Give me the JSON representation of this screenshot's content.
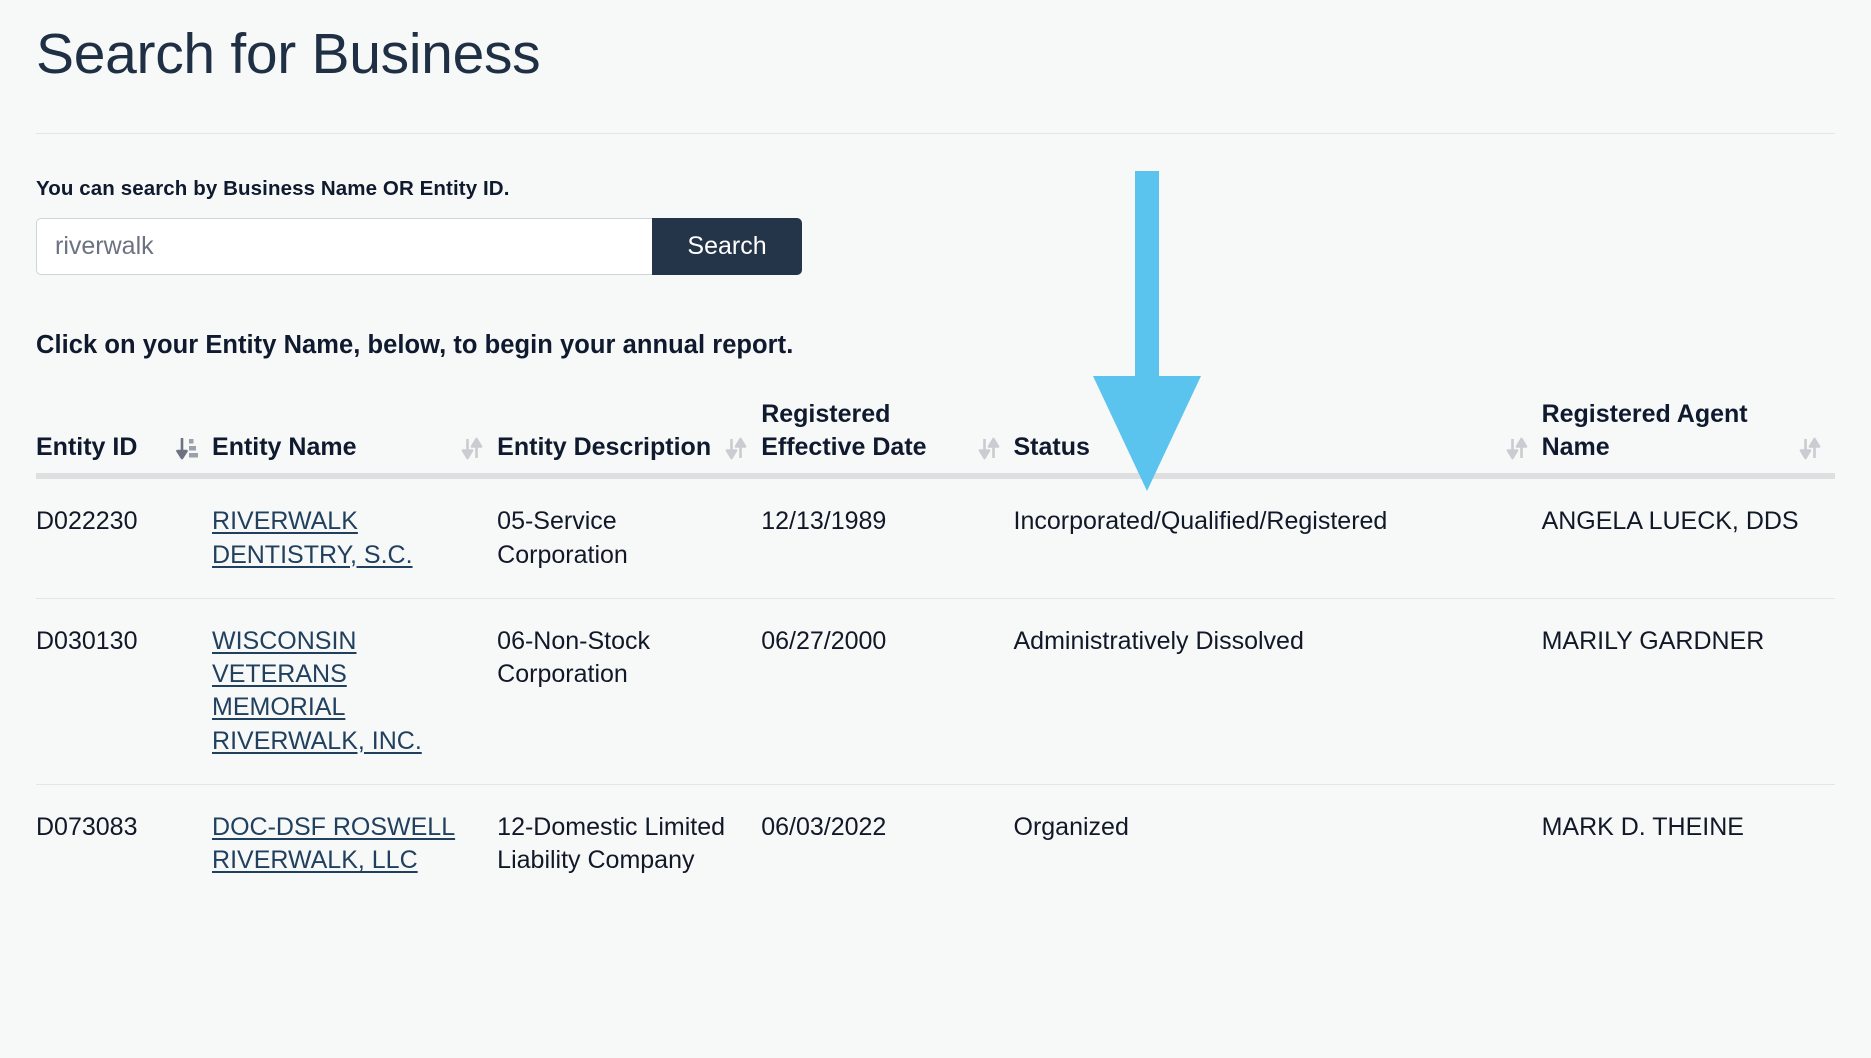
{
  "header": {
    "title": "Search for Business"
  },
  "search": {
    "help_text": "You can search by Business Name OR Entity ID.",
    "value": "riverwalk",
    "placeholder": "riverwalk",
    "button_label": "Search"
  },
  "instruction": "Click on your Entity Name, below, to begin your annual report.",
  "annotation": {
    "arrow_icon": "down-arrow-annotation",
    "color": "#5BC4EE",
    "points_to": "Status"
  },
  "table": {
    "columns": [
      {
        "label": "Entity ID",
        "sort_icon": "sort-amount-down-icon",
        "sorted": true
      },
      {
        "label": "Entity Name",
        "sort_icon": "sort-updown-icon",
        "sorted": false
      },
      {
        "label": "Entity Description",
        "sort_icon": "sort-updown-icon",
        "sorted": false
      },
      {
        "label": "Registered Effective Date",
        "sort_icon": "sort-updown-icon",
        "sorted": false
      },
      {
        "label": "Status",
        "sort_icon": "sort-updown-icon",
        "sorted": false
      },
      {
        "label": "Registered Agent Name",
        "sort_icon": "sort-updown-icon",
        "sorted": false
      }
    ],
    "rows": [
      {
        "entity_id": "D022230",
        "entity_name": "RIVERWALK DENTISTRY, S.C.",
        "entity_description": "05-Service Corporation",
        "registered_effective_date": "12/13/1989",
        "status": "Incorporated/Qualified/Registered",
        "registered_agent_name": "ANGELA LUECK, DDS"
      },
      {
        "entity_id": "D030130",
        "entity_name": "WISCONSIN VETERANS MEMORIAL RIVERWALK, INC.",
        "entity_description": "06-Non-Stock Corporation",
        "registered_effective_date": "06/27/2000",
        "status": "Administratively Dissolved",
        "registered_agent_name": "MARILY GARDNER"
      },
      {
        "entity_id": "D073083",
        "entity_name": "DOC-DSF ROSWELL RIVERWALK, LLC",
        "entity_description": "12-Domestic Limited Liability Company",
        "registered_effective_date": "06/03/2022",
        "status": "Organized",
        "registered_agent_name": "MARK D. THEINE"
      }
    ]
  }
}
